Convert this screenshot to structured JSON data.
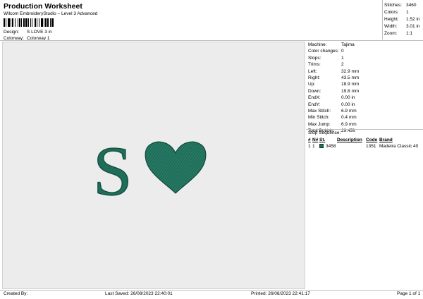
{
  "header": {
    "title": "Production Worksheet",
    "subtitle": "Wilcom EmbroideryStudio – Level 3 Advanced"
  },
  "design_info": {
    "design_label": "Design:",
    "design_value": "S LOVE 3 in",
    "colorway_label": "Colorway:",
    "colorway_value": "Colorway 1"
  },
  "stats": [
    {
      "label": "Stitches:",
      "value": "3460"
    },
    {
      "label": "Colors:",
      "value": "1"
    },
    {
      "label": "Height:",
      "value": "1.52 in"
    },
    {
      "label": "Width:",
      "value": "3.01 in"
    },
    {
      "label": "Zoom:",
      "value": "1:1"
    }
  ],
  "machine_info": [
    {
      "label": "Machine:",
      "value": "Tajima"
    },
    {
      "label": "Color changes:",
      "value": "0"
    },
    {
      "label": "Stops:",
      "value": "1"
    },
    {
      "label": "Trims:",
      "value": "2"
    },
    {
      "label": "Left:",
      "value": "32.9 mm"
    },
    {
      "label": "Right:",
      "value": "43.5 mm"
    },
    {
      "label": "Up:",
      "value": "18.9 mm"
    },
    {
      "label": "Down:",
      "value": "19.8 mm"
    },
    {
      "label": "EndX:",
      "value": "0.00 in"
    },
    {
      "label": "EndY:",
      "value": "0.00 in"
    },
    {
      "label": "Max Stitch:",
      "value": "6.9 mm"
    },
    {
      "label": "Min Stitch:",
      "value": "0.4 mm"
    },
    {
      "label": "Max Jump:",
      "value": "6.9 mm"
    },
    {
      "label": "Total Bobbin:",
      "value": "29.45ft"
    }
  ],
  "stop_sequence": {
    "title": "Stop Sequence:",
    "headers": [
      "#",
      "N#",
      "St.",
      "Description",
      "Code",
      "Brand"
    ],
    "rows": [
      {
        "num": "1",
        "n": "1",
        "stitches": "3458",
        "description": "",
        "code": "1351",
        "brand": "Madeira Classic 40",
        "color": "#1e6e5a"
      }
    ]
  },
  "design": {
    "letter": "S",
    "thread_color": "#1e6e5a",
    "thread_highlight": "#3a8c76",
    "thread_shadow": "#0f4a3c"
  },
  "footer": {
    "created_by": "Created By:",
    "last_saved": "Last Saved: 26/08/2023 22:40:01",
    "printed": "Printed: 26/08/2023 22:41:17",
    "page": "Page 1 of 1"
  }
}
